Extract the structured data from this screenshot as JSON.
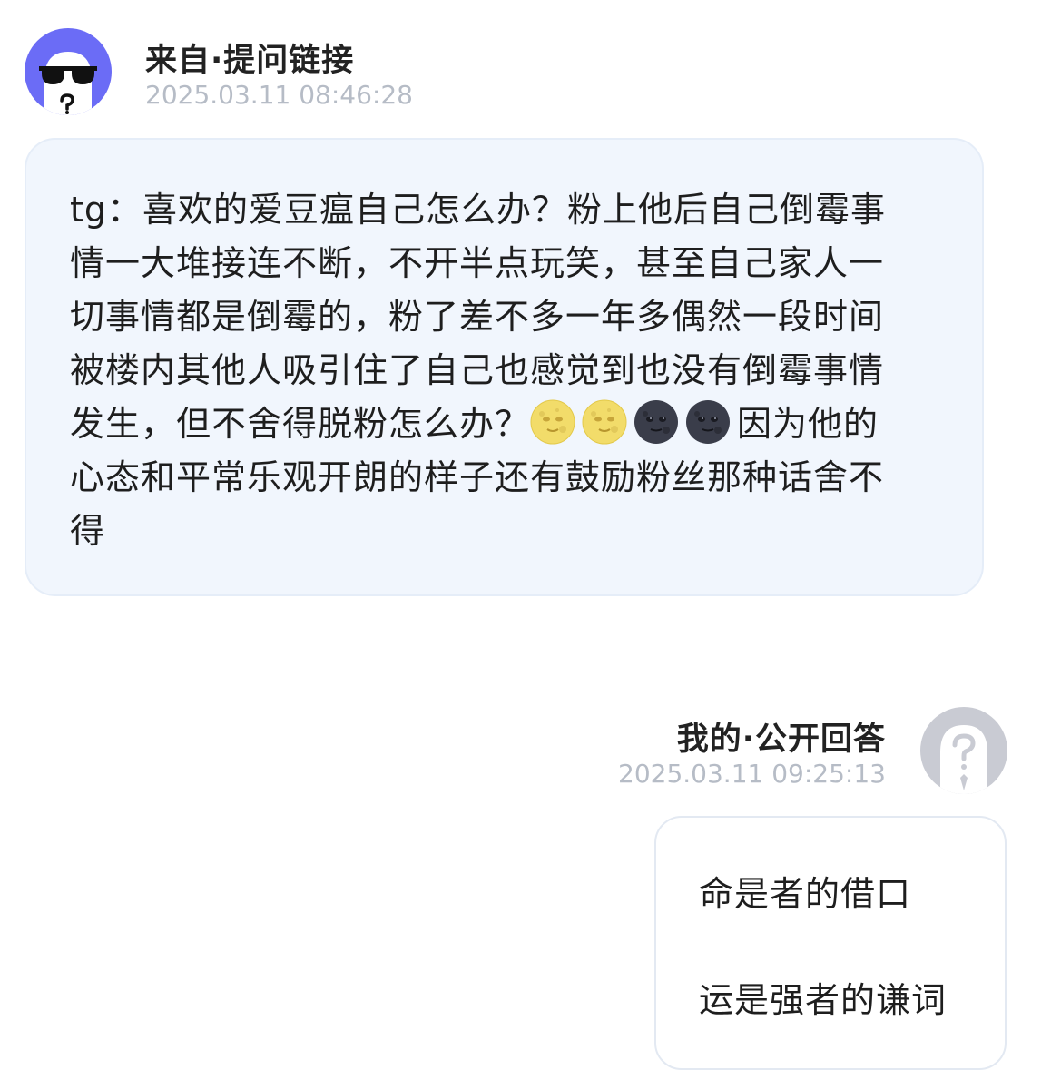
{
  "question": {
    "sender": "来自·提问链接",
    "timestamp": "2025.03.11 08:46:28",
    "avatar_icon": "sunglasses-ghost-icon",
    "text": "tg：喜欢的爱豆瘟自己怎么办？粉上他后自己倒霉事情一大堆接连不断，不开半点玩笑，甚至自己家人一切事情都是倒霉的，粉了差不多一年多偶然一段时间被楼内其他人吸引住了自己也感觉到也没有倒霉事情发生，但不舍得脱粉怎么办？",
    "emojis": [
      "full-moon-face-emoji",
      "full-moon-face-emoji",
      "new-moon-face-emoji",
      "new-moon-face-emoji"
    ],
    "text_after": "因为他的心态和平常乐观开朗的样子还有鼓励粉丝那种话舍不得",
    "bubble_color": "#f1f6fd"
  },
  "answer": {
    "sender": "我的·公开回答",
    "timestamp": "2025.03.11 09:25:13",
    "avatar_icon": "anonymous-question-icon",
    "line1": "命是者的借口",
    "line2": "运是强者的谦词"
  },
  "colors": {
    "accent": "#6b6cf6",
    "timestamp": "#b6bcc6",
    "anon_avatar": "#c9cbd3"
  }
}
